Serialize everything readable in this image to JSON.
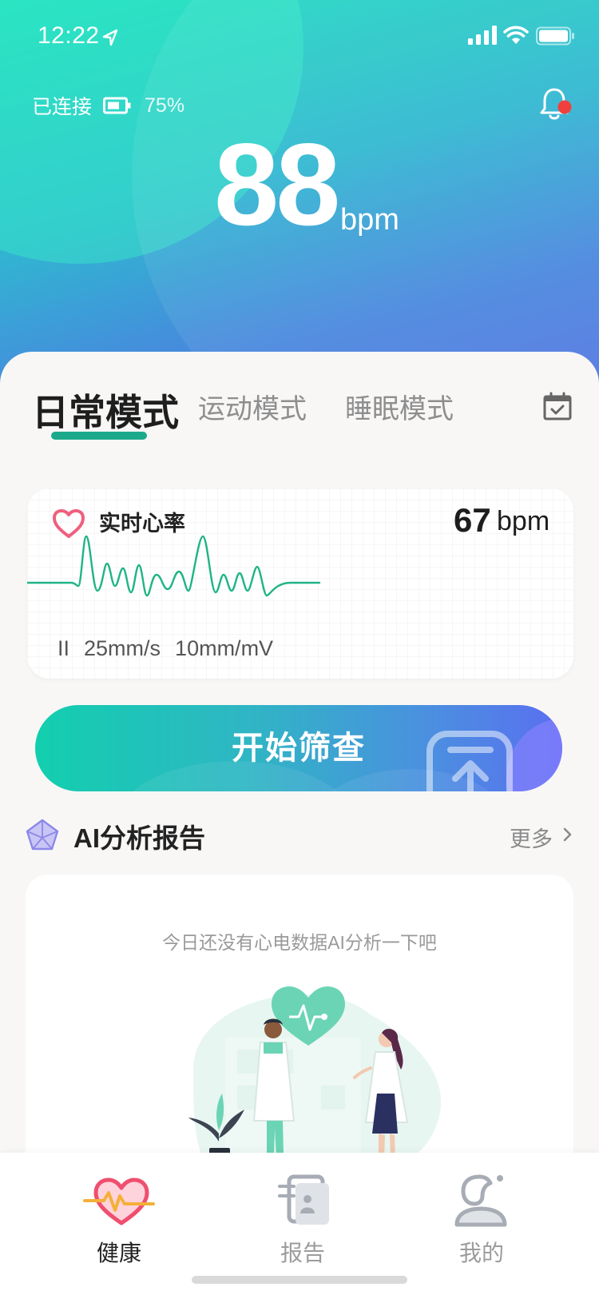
{
  "status_bar": {
    "time": "12:22"
  },
  "device": {
    "connection_label": "已连接",
    "battery_percent": "75%"
  },
  "heart_rate": {
    "value": "88",
    "unit": "bpm"
  },
  "mode_tabs": [
    {
      "label": "日常模式",
      "active": true
    },
    {
      "label": "运动模式",
      "active": false
    },
    {
      "label": "睡眠模式",
      "active": false
    }
  ],
  "ecg_card": {
    "title": "实时心率",
    "value": "67",
    "unit": "bpm",
    "lead": "II",
    "speed": "25mm/s",
    "gain": "10mm/mV"
  },
  "start_button": {
    "label": "开始筛查"
  },
  "ai_section": {
    "title": "AI分析报告",
    "more_label": "更多",
    "empty_text": "今日还没有心电数据AI分析一下吧"
  },
  "tabbar": [
    {
      "label": "健康",
      "icon": "heart-pulse-icon",
      "active": true
    },
    {
      "label": "报告",
      "icon": "report-icon",
      "active": false
    },
    {
      "label": "我的",
      "icon": "profile-icon",
      "active": false
    }
  ],
  "colors": {
    "accent": "#1ba98b",
    "heart_pink": "#ef5f7e",
    "ecg_line": "#1fb486",
    "notification_dot": "#f0403e"
  }
}
